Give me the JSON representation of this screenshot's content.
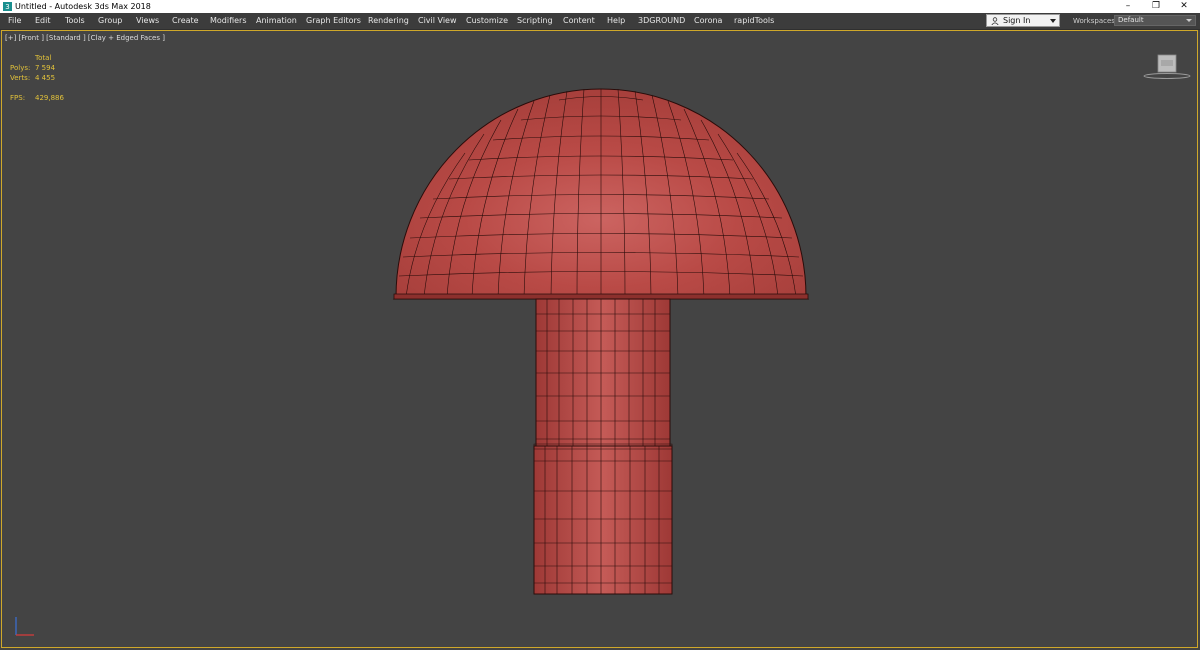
{
  "window": {
    "title": "Untitled - Autodesk 3ds Max 2018",
    "icon": "3ds-max-app-icon",
    "controls": [
      "minimize-icon",
      "restore-icon",
      "close-icon"
    ]
  },
  "menu": {
    "items": [
      "File",
      "Edit",
      "Tools",
      "Group",
      "Views",
      "Create",
      "Modifiers",
      "Animation",
      "Graph Editors",
      "Rendering",
      "Civil View",
      "Customize",
      "Scripting",
      "Content",
      "Help",
      "3DGROUND",
      "Corona",
      "rapidTools"
    ]
  },
  "account": {
    "sign_in_label": "Sign In",
    "icon": "user-icon"
  },
  "workspaces": {
    "label": "Workspaces:",
    "value": "Default"
  },
  "viewport": {
    "label": "[+] [Front ] [Standard ] [Clay + Edged Faces ]",
    "stats": {
      "header": "Total",
      "polys_label": "Polys:",
      "polys_value": "7 594",
      "verts_label": "Verts:",
      "verts_value": "4 455",
      "fps_label": "FPS:",
      "fps_value": "429,886"
    },
    "viewcube_icon": "viewcube-icon",
    "gizmo_icon": "axis-gizmo-icon"
  },
  "colors": {
    "viewport_bg": "#444444",
    "menu_bg": "#3c3c3c",
    "model_fill": "#b5423f",
    "wire": "#2a0c0a",
    "stats_text": "#e2c23a",
    "active_border": "#cfa82a"
  }
}
